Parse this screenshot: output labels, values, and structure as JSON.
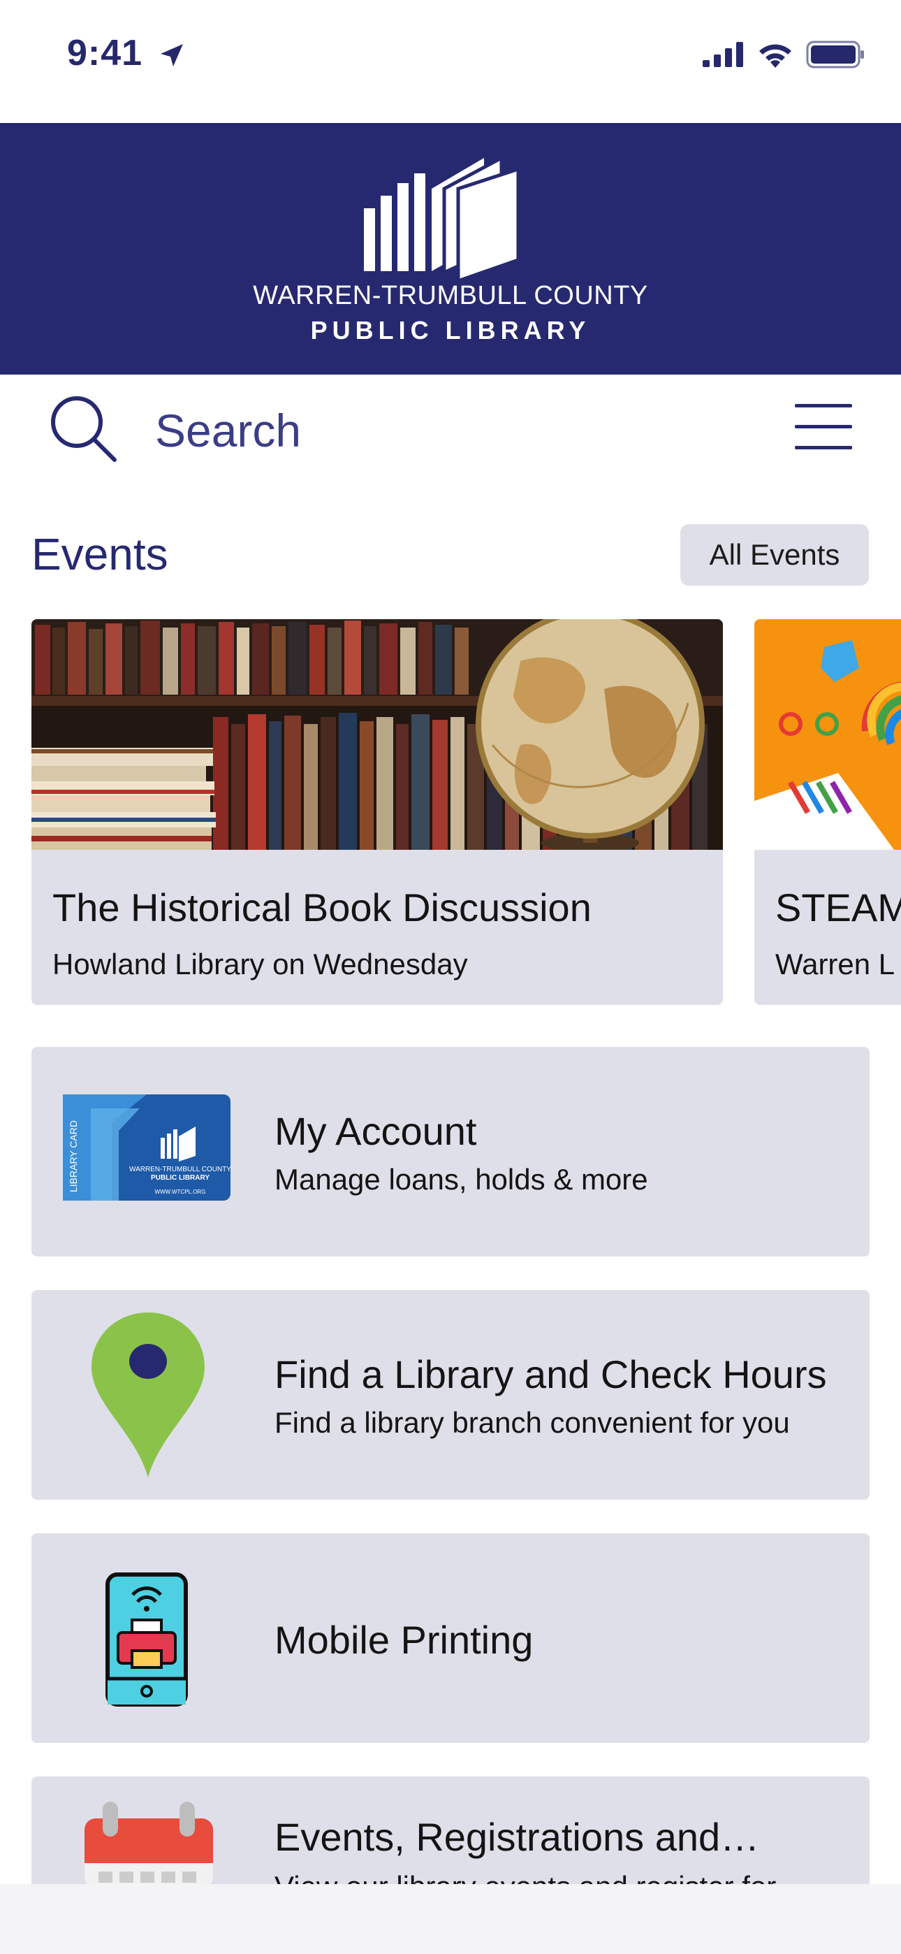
{
  "status_bar": {
    "time": "9:41",
    "icons": [
      "location-arrow-icon",
      "cellular-signal-icon",
      "wifi-icon",
      "battery-icon"
    ]
  },
  "header": {
    "logo_line1": "WARREN-TRUMBULL COUNTY",
    "logo_line2": "PUBLIC LIBRARY",
    "background": "#272970"
  },
  "search": {
    "placeholder": "Search"
  },
  "events": {
    "title": "Events",
    "all_events_label": "All Events",
    "cards": [
      {
        "title": "The Historical Book Discussion",
        "subtitle": "Howland Library on Wednesday"
      },
      {
        "title": "STEAM",
        "subtitle": "Warren L"
      }
    ]
  },
  "menu_items": [
    {
      "title": "My Account",
      "subtitle": "Manage loans, holds & more",
      "icon": "library-card-icon"
    },
    {
      "title": "Find a Library and Check Hours",
      "subtitle": "Find a library branch convenient for you",
      "icon": "map-pin-icon"
    },
    {
      "title": "Mobile Printing",
      "subtitle": "",
      "icon": "mobile-printer-icon"
    },
    {
      "title": "Events, Registrations and…",
      "subtitle": "View our library events and register for",
      "icon": "calendar-icon"
    }
  ],
  "library_card": {
    "side_text": "LIBRARY CARD",
    "line1": "WARREN-TRUMBULL COUNTY",
    "line2": "PUBLIC LIBRARY",
    "url": "WWW.WTCPL.ORG"
  },
  "colors": {
    "brand": "#272970",
    "card_bg": "#dfdfe9",
    "pin_green": "#8bc34a"
  }
}
